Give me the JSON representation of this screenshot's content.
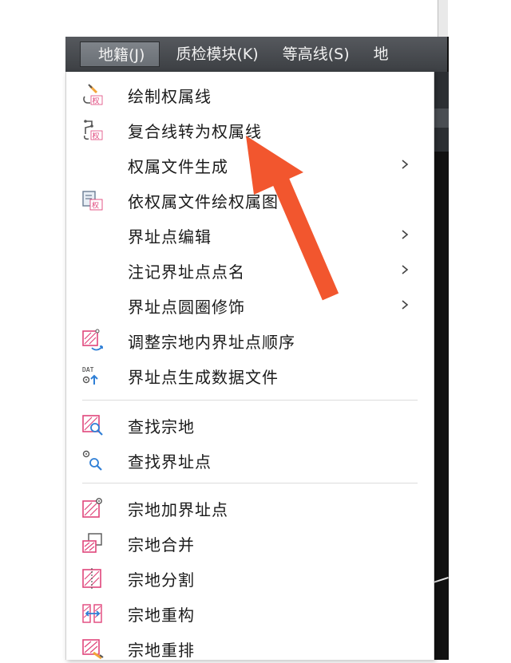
{
  "menubar": {
    "tabs": [
      {
        "label": "地籍(J)"
      },
      {
        "label": "质检模块(K)"
      },
      {
        "label": "等高线(S)"
      },
      {
        "label": "地"
      }
    ]
  },
  "menu": {
    "items": [
      {
        "label": "绘制权属线"
      },
      {
        "label": "复合线转为权属线"
      },
      {
        "label": "权属文件生成"
      },
      {
        "label": "依权属文件绘权属图"
      },
      {
        "label": "界址点编辑"
      },
      {
        "label": "注记界址点点名"
      },
      {
        "label": "界址点圆圈修饰"
      },
      {
        "label": "调整宗地内界址点顺序"
      },
      {
        "label": "界址点生成数据文件"
      },
      {
        "label": "查找宗地"
      },
      {
        "label": "查找界址点"
      },
      {
        "label": "宗地加界址点"
      },
      {
        "label": "宗地合并"
      },
      {
        "label": "宗地分割"
      },
      {
        "label": "宗地重构"
      },
      {
        "label": "宗地重排"
      }
    ],
    "icon_text": {
      "quan": "权",
      "dat": "DAT"
    }
  },
  "colors": {
    "menubar_bg": "#4a4d52",
    "icon_pink": "#e0457b",
    "icon_blue": "#2f7fd6",
    "icon_orange": "#f2a43a",
    "arrow": "#f2562e"
  }
}
